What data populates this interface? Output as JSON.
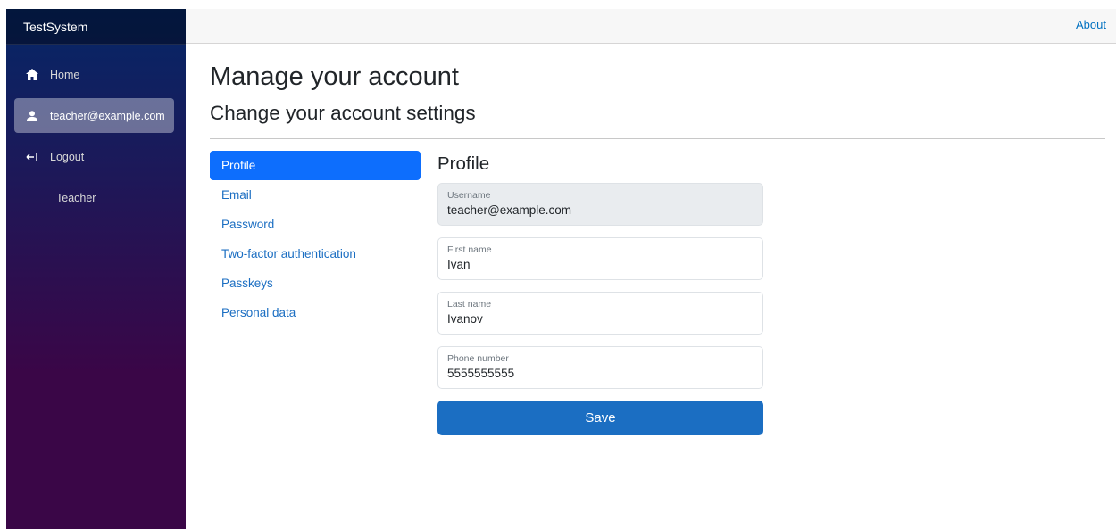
{
  "app": {
    "brand": "TestSystem"
  },
  "topbar": {
    "about_label": "About"
  },
  "sidebar": {
    "items": [
      {
        "label": "Home",
        "icon": "home-icon"
      },
      {
        "label": "teacher@example.com",
        "icon": "user-icon",
        "active": true
      },
      {
        "label": "Logout",
        "icon": "logout-icon"
      },
      {
        "label": "Teacher",
        "icon": ""
      }
    ]
  },
  "main": {
    "title": "Manage your account",
    "subtitle": "Change your account settings"
  },
  "side_nav": {
    "items": [
      {
        "label": "Profile",
        "active": true
      },
      {
        "label": "Email"
      },
      {
        "label": "Password"
      },
      {
        "label": "Two-factor authentication"
      },
      {
        "label": "Passkeys"
      },
      {
        "label": "Personal data"
      }
    ]
  },
  "profile": {
    "section_title": "Profile",
    "fields": [
      {
        "label": "Username",
        "value": "teacher@example.com",
        "disabled": true
      },
      {
        "label": "First name",
        "value": "Ivan"
      },
      {
        "label": "Last name",
        "value": "Ivanov"
      },
      {
        "label": "Phone number",
        "value": "5555555555"
      }
    ],
    "save_label": "Save"
  },
  "colors": {
    "accent": "#1b6ec2",
    "active_tab": "#0d6efd",
    "sidebar_top": "#052767",
    "sidebar_bottom": "#3a0647"
  }
}
